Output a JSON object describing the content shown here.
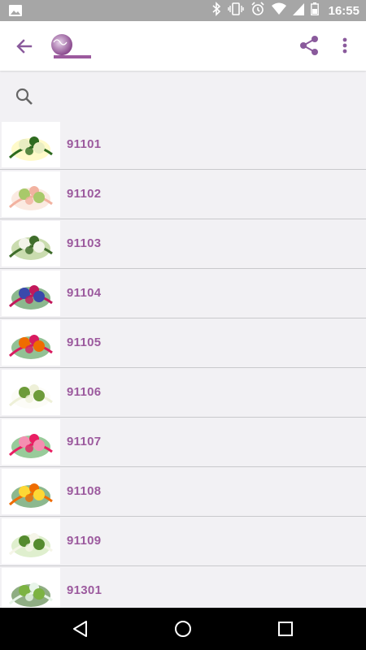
{
  "status_bar": {
    "time": "16:55"
  },
  "app_bar": {
    "colors": {
      "accent": "#9c5a9e",
      "icon": "#8a5a9c"
    }
  },
  "search": {
    "placeholder": ""
  },
  "products": [
    {
      "code": "91101",
      "image": "flower-arrangement"
    },
    {
      "code": "91102",
      "image": "flower-arrangement"
    },
    {
      "code": "91103",
      "image": "flower-arrangement"
    },
    {
      "code": "91104",
      "image": "flower-arrangement"
    },
    {
      "code": "91105",
      "image": "flower-arrangement"
    },
    {
      "code": "91106",
      "image": "flower-arrangement"
    },
    {
      "code": "91107",
      "image": "flower-arrangement"
    },
    {
      "code": "91108",
      "image": "flower-arrangement"
    },
    {
      "code": "91109",
      "image": "flower-arrangement"
    },
    {
      "code": "91301",
      "image": "flower-arrangement"
    }
  ]
}
